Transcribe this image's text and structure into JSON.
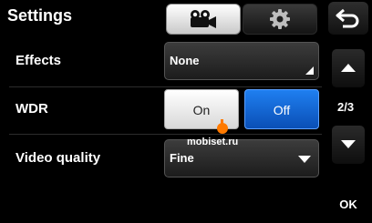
{
  "header": {
    "title": "Settings",
    "tabs": [
      {
        "id": "video",
        "icon": "video-camera-icon",
        "selected": true
      },
      {
        "id": "settings",
        "icon": "gear-icon",
        "selected": false
      }
    ],
    "back_icon": "back-arrow-icon"
  },
  "rows": {
    "effects": {
      "label": "Effects",
      "value": "None"
    },
    "wdr": {
      "label": "WDR",
      "on_label": "On",
      "off_label": "Off",
      "selected": "Off"
    },
    "video_quality": {
      "label": "Video quality",
      "value": "Fine"
    }
  },
  "side": {
    "page_indicator": "2/3",
    "ok_label": "OK"
  },
  "watermark": "mobiset.ru",
  "colors": {
    "accent": "#1a6fe0",
    "background": "#000000"
  }
}
